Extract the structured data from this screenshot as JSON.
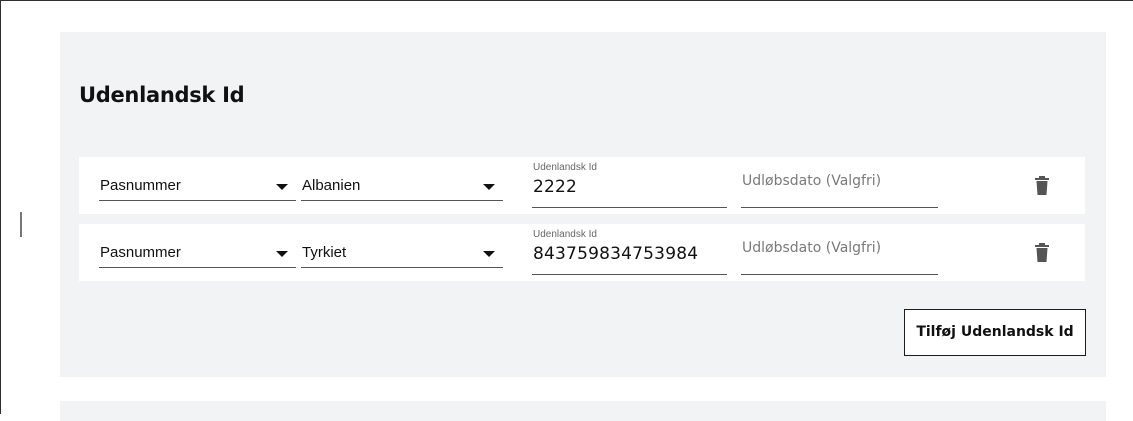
{
  "section": {
    "title": "Udenlandsk Id",
    "add_button_label": "Tilføj Udenlandsk Id"
  },
  "rows": [
    {
      "id_type": "Pasnummer",
      "country": "Albanien",
      "id_label": "Udenlandsk Id",
      "id_value": "2222",
      "expiry_placeholder": "Udløbsdato (Valgfri)"
    },
    {
      "id_type": "Pasnummer",
      "country": "Tyrkiet",
      "id_label": "Udenlandsk Id",
      "id_value": "843759834753984",
      "expiry_placeholder": "Udløbsdato (Valgfri)"
    }
  ],
  "icons": {
    "delete": "trash-icon",
    "dropdown": "caret-down-icon"
  },
  "colors": {
    "panel_background": "#f2f3f5",
    "row_background": "#ffffff",
    "text": "#111111",
    "placeholder": "#7a7a7a",
    "underline": "#555555"
  }
}
